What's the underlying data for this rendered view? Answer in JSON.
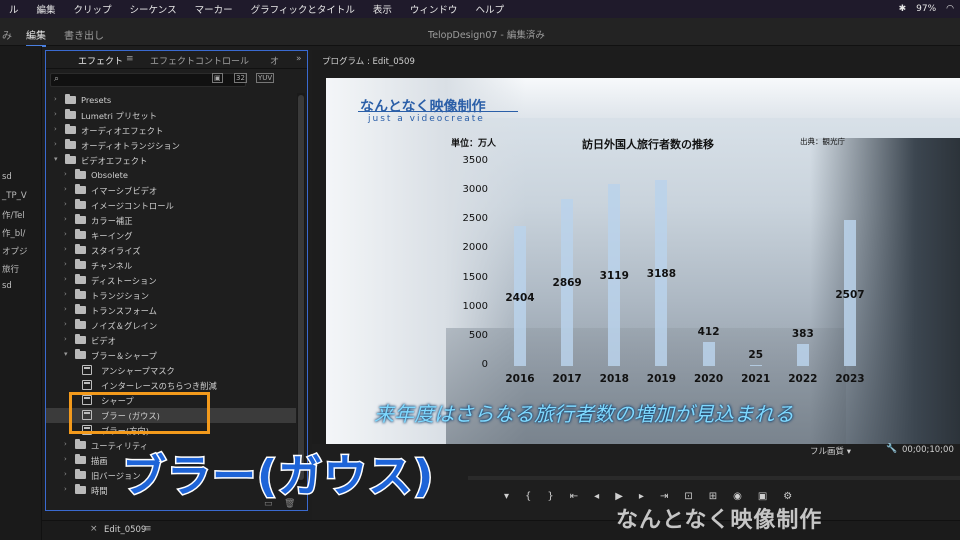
{
  "menubar": {
    "items": [
      "ル",
      "編集",
      "クリップ",
      "シーケンス",
      "マーカー",
      "グラフィックとタイトル",
      "表示",
      "ウィンドウ",
      "ヘルプ"
    ],
    "battery": "97%"
  },
  "workspace": {
    "tabs": [
      "み",
      "編集",
      "書き出し"
    ],
    "window_title": "TelopDesign07 - 編集済み"
  },
  "left_strip": [
    "sd",
    "_TP_V",
    "作/Tel",
    "作_bl/",
    "オプジ",
    "旅行",
    "sd"
  ],
  "effects_panel": {
    "tab_effects": "エフェクト",
    "tab_effect_controls": "エフェクトコントロール",
    "tab_more": "オ",
    "tree": [
      {
        "label": "Presets",
        "depth": 0,
        "open": false,
        "type": "folder"
      },
      {
        "label": "Lumetri プリセット",
        "depth": 0,
        "open": false,
        "type": "folder"
      },
      {
        "label": "オーディオエフェクト",
        "depth": 0,
        "open": false,
        "type": "folder"
      },
      {
        "label": "オーディオトランジション",
        "depth": 0,
        "open": false,
        "type": "folder"
      },
      {
        "label": "ビデオエフェクト",
        "depth": 0,
        "open": true,
        "type": "folder"
      },
      {
        "label": "Obsolete",
        "depth": 1,
        "open": false,
        "type": "folder"
      },
      {
        "label": "イマーシブビデオ",
        "depth": 1,
        "open": false,
        "type": "folder"
      },
      {
        "label": "イメージコントロール",
        "depth": 1,
        "open": false,
        "type": "folder"
      },
      {
        "label": "カラー補正",
        "depth": 1,
        "open": false,
        "type": "folder"
      },
      {
        "label": "キーイング",
        "depth": 1,
        "open": false,
        "type": "folder"
      },
      {
        "label": "スタイライズ",
        "depth": 1,
        "open": false,
        "type": "folder"
      },
      {
        "label": "チャンネル",
        "depth": 1,
        "open": false,
        "type": "folder"
      },
      {
        "label": "ディストーション",
        "depth": 1,
        "open": false,
        "type": "folder"
      },
      {
        "label": "トランジション",
        "depth": 1,
        "open": false,
        "type": "folder"
      },
      {
        "label": "トランスフォーム",
        "depth": 1,
        "open": false,
        "type": "folder"
      },
      {
        "label": "ノイズ＆グレイン",
        "depth": 1,
        "open": false,
        "type": "folder"
      },
      {
        "label": "ビデオ",
        "depth": 1,
        "open": false,
        "type": "folder"
      },
      {
        "label": "ブラー＆シャープ",
        "depth": 1,
        "open": true,
        "type": "folder"
      },
      {
        "label": "アンシャープマスク",
        "depth": 2,
        "type": "effect"
      },
      {
        "label": "インターレースのちらつき削減",
        "depth": 2,
        "type": "effect"
      },
      {
        "label": "シャープ",
        "depth": 2,
        "type": "effect"
      },
      {
        "label": "ブラー (ガウス)",
        "depth": 2,
        "type": "effect",
        "selected": true
      },
      {
        "label": "ブラー(方向)",
        "depth": 2,
        "type": "effect"
      },
      {
        "label": "ユーティリティ",
        "depth": 1,
        "open": false,
        "type": "folder"
      },
      {
        "label": "描画",
        "depth": 1,
        "open": false,
        "type": "folder"
      },
      {
        "label": "旧バージョン",
        "depth": 1,
        "open": false,
        "type": "folder"
      },
      {
        "label": "時間",
        "depth": 1,
        "open": false,
        "type": "folder"
      }
    ]
  },
  "overlay_caption": "ブラー(ガウス)",
  "program_monitor": {
    "title": "プログラム : Edit_0509",
    "fit": "フル画質",
    "timecode": "00;00;10;00"
  },
  "video_overlay": {
    "logo": "なんとなく映像制作",
    "logo_sub": "just a videocreate",
    "subtitle": "来年度はさらなる旅行者数の増加が見込まれる"
  },
  "chart_data": {
    "type": "bar",
    "title": "訪日外国人旅行者数の推移",
    "unit_label": "単位：万人",
    "source": "出典：観光庁",
    "categories": [
      "2016",
      "2017",
      "2018",
      "2019",
      "2020",
      "2021",
      "2022",
      "2023"
    ],
    "values": [
      2404,
      2869,
      3119,
      3188,
      412,
      25,
      383,
      2507
    ],
    "yticks": [
      "3500",
      "3000",
      "2500",
      "2000",
      "1500",
      "1000",
      "500",
      "0"
    ],
    "ylim": [
      0,
      3500
    ]
  },
  "timeline_tab": "Edit_0509",
  "watermark": "なんとなく映像制作"
}
